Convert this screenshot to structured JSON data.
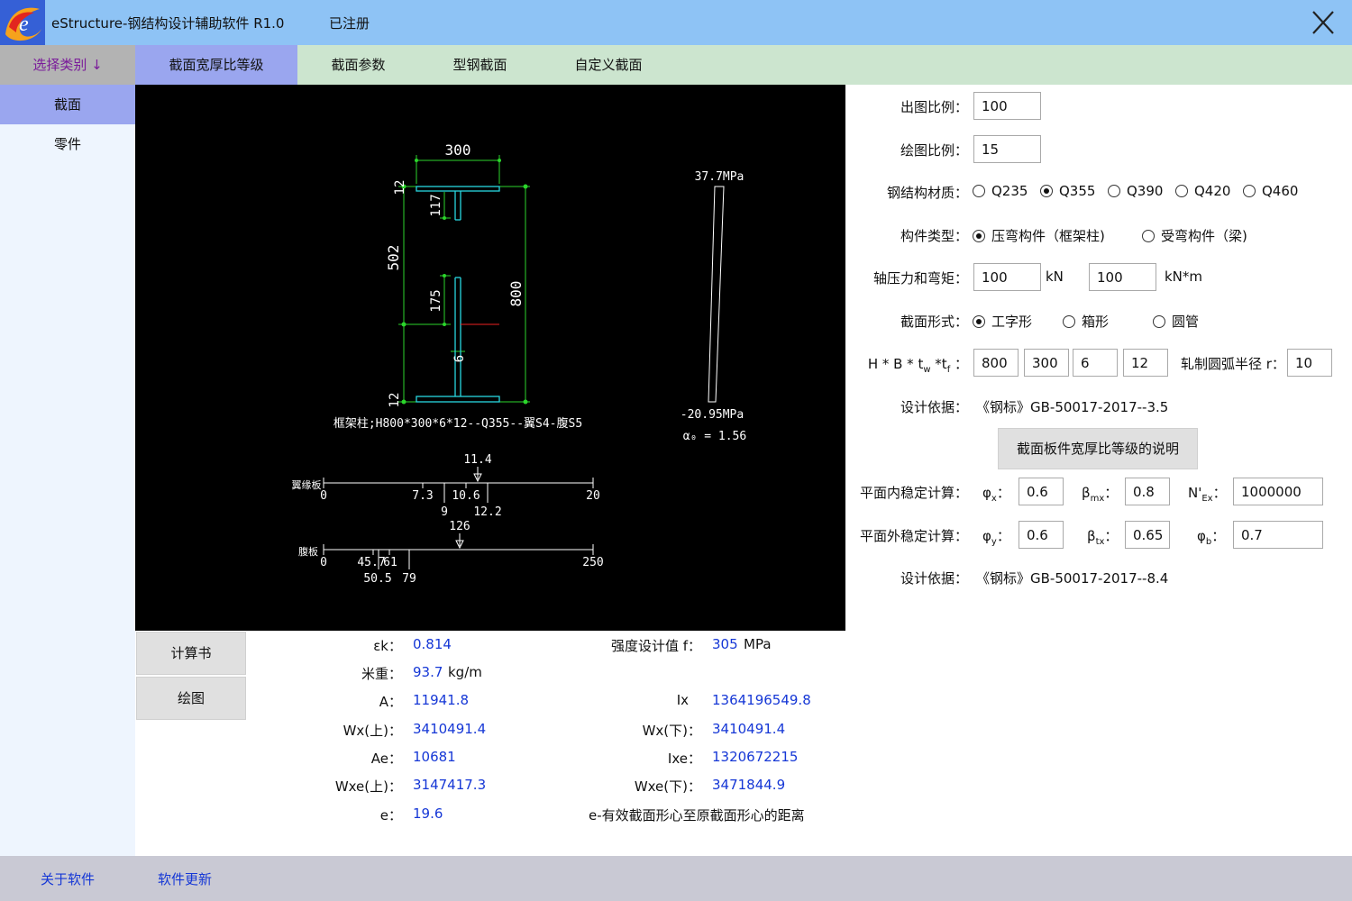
{
  "app": {
    "title": "eStructure-钢结构设计辅助软件 R1.0",
    "reg_status": "已注册",
    "logo_icon": "phoenix-logo",
    "close_icon": "close-icon"
  },
  "tabs": {
    "category": "选择类别 ↓",
    "items": [
      "截面宽厚比等级",
      "截面参数",
      "型钢截面",
      "自定义截面"
    ],
    "active_index": 0
  },
  "sidebar": {
    "items": [
      "截面",
      "零件"
    ],
    "active_index": 0
  },
  "drawing": {
    "dim_top": "300",
    "dim_flange_top": "12",
    "dim_flange_bottom": "12",
    "dim_502": "502",
    "dim_117": "117",
    "dim_175": "175",
    "dim_800": "800",
    "dim_web": "6",
    "caption": "框架柱;H800*300*6*12--Q355--翼S4-腹S5",
    "stress_top": "37.7MPa",
    "stress_bottom": "-20.95MPa",
    "alpha": "α₀ = 1.56",
    "scale1": {
      "name": "翼缘板",
      "marker": "11.4",
      "start": "0",
      "end": "20",
      "ticks_above": [
        "7.3",
        "10.6"
      ],
      "ticks_below": [
        "9",
        "12.2"
      ]
    },
    "scale2": {
      "name": "腹板",
      "marker": "126",
      "start": "0",
      "end": "250",
      "ticks_above": [
        "45.7",
        "61"
      ],
      "ticks_below": [
        "50.5",
        "79"
      ]
    }
  },
  "buttons": {
    "calc_book": "计算书",
    "draw": "绘图",
    "explain": "截面板件宽厚比等级的说明"
  },
  "results": {
    "ek_label": "εk：",
    "ek": "0.814",
    "f_label": "强度设计值 f：",
    "f": "305",
    "f_unit": "MPa",
    "mass_label": "米重：",
    "mass": "93.7",
    "mass_unit": "kg/m",
    "A_label": "A：",
    "A": "11941.8",
    "Ix_label": "Ix",
    "Ix": "1364196549.8",
    "Wx_top_label": "Wx(上)：",
    "Wx_top": "3410491.4",
    "Wx_bot_label": "Wx(下)：",
    "Wx_bot": "3410491.4",
    "Ae_label": "Ae：",
    "Ae": "10681",
    "Ixe_label": "Ixe：",
    "Ixe": "1320672215",
    "Wxe_top_label": "Wxe(上)：",
    "Wxe_top": "3147417.3",
    "Wxe_bot_label": "Wxe(下)：",
    "Wxe_bot": "3471844.9",
    "e_label": "e：",
    "e": "19.6",
    "e_note": "e-有效截面形心至原截面形心的距离"
  },
  "form": {
    "output_scale_label": "出图比例：",
    "output_scale": "100",
    "draw_scale_label": "绘图比例：",
    "draw_scale": "15",
    "material_label": "钢结构材质：",
    "materials": [
      "Q235",
      "Q355",
      "Q390",
      "Q420",
      "Q460"
    ],
    "material_selected": 1,
    "member_type_label": "构件类型：",
    "member_types": [
      "压弯构件（框架柱)",
      "受弯构件（梁)"
    ],
    "member_type_selected": 0,
    "force_label": "轴压力和弯矩：",
    "axial_force": "100",
    "axial_unit": "kN",
    "moment": "100",
    "moment_unit": "kN*m",
    "section_label": "截面形式：",
    "sections": [
      "工字形",
      "箱形",
      "圆管"
    ],
    "section_selected": 0,
    "dims_label_prefix": "H * B * t",
    "H": "800",
    "B": "300",
    "tw": "6",
    "tf": "12",
    "radius_label": "轧制圆弧半径 r：",
    "radius": "10",
    "basis_label": "设计依据：",
    "basis1": "《钢标》GB-50017-2017--3.5",
    "inplane_label": "平面内稳定计算：",
    "phi_x": "0.6",
    "beta_mx": "0.8",
    "N_Ex": "1000000",
    "outplane_label": "平面外稳定计算：",
    "phi_y": "0.6",
    "beta_tx": "0.65",
    "phi_b": "0.7",
    "basis2": "《钢标》GB-50017-2017--8.4"
  },
  "footer": {
    "about": "关于软件",
    "update": "软件更新"
  }
}
